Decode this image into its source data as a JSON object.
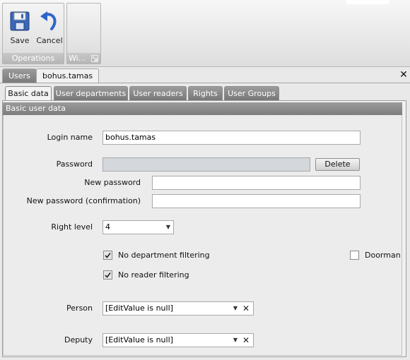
{
  "ribbon": {
    "groups": [
      {
        "label": "Operations",
        "buttons": [
          {
            "label": "Save",
            "icon": "floppy-disk-icon"
          },
          {
            "label": "Cancel",
            "icon": "undo-arrow-icon"
          }
        ]
      },
      {
        "label": "Wi..."
      }
    ]
  },
  "doc_tabs": [
    {
      "label": "Users"
    },
    {
      "label": "bohus.tamas"
    }
  ],
  "inner_tabs": [
    {
      "label": "Basic data"
    },
    {
      "label": "User departments"
    },
    {
      "label": "User readers"
    },
    {
      "label": "Rights"
    },
    {
      "label": "User Groups"
    }
  ],
  "section": {
    "title": "Basic user data"
  },
  "form": {
    "login_name": {
      "label": "Login name",
      "value": "bohus.tamas"
    },
    "password": {
      "label": "Password",
      "value": "",
      "delete_label": "Delete"
    },
    "new_password": {
      "label": "New password",
      "value": ""
    },
    "new_password_confirm": {
      "label": "New password (confirmation)",
      "value": ""
    },
    "right_level": {
      "label": "Right level",
      "value": "4"
    },
    "no_department_filtering": {
      "label": "No department filtering",
      "checked": true
    },
    "no_reader_filtering": {
      "label": "No reader filtering",
      "checked": true
    },
    "doorman": {
      "label": "Doorman",
      "checked": false
    },
    "person": {
      "label": "Person",
      "value": "[EditValue is null]"
    },
    "deputy": {
      "label": "Deputy",
      "value": "[EditValue is null]"
    }
  },
  "colors": {
    "ribbon_label_bg": "#bcbcbc",
    "tab_inactive": "#8a8a8a",
    "section_header": "#8c8c8c"
  }
}
